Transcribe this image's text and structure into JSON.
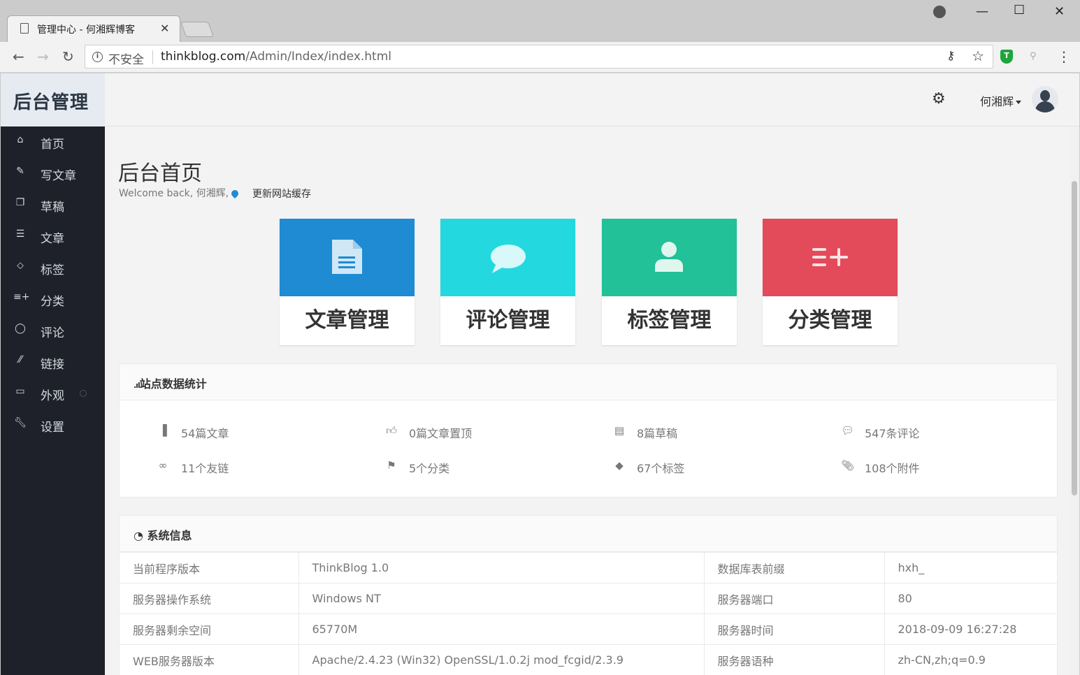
{
  "browser": {
    "tab_title": "管理中心 - 何湘辉博客",
    "tab_close": "✕",
    "insecure_label": "不安全",
    "url_host": "thinkblog.com",
    "url_path": "/Admin/Index/index.html",
    "ext_shield_letter": "T"
  },
  "brand": {
    "title": "后台管理"
  },
  "topbar": {
    "user_name": "何湘辉"
  },
  "sidebar": {
    "items": [
      {
        "label": "首页",
        "icon": "home-icon"
      },
      {
        "label": "写文章",
        "icon": "edit-icon"
      },
      {
        "label": "草稿",
        "icon": "copy-icon"
      },
      {
        "label": "文章",
        "icon": "list-icon"
      },
      {
        "label": "标签",
        "icon": "tag-icon"
      },
      {
        "label": "分类",
        "icon": "category-plus-icon"
      },
      {
        "label": "评论",
        "icon": "comment-icon"
      },
      {
        "label": "链接",
        "icon": "link-icon"
      },
      {
        "label": "外观",
        "icon": "monitor-icon"
      },
      {
        "label": "设置",
        "icon": "wrench-icon"
      }
    ]
  },
  "header": {
    "title": "后台首页",
    "welcome": "Welcome back, 何湘辉,",
    "refresh_cache": "更新网站缓存"
  },
  "cards": [
    {
      "label": "文章管理",
      "color": "#1e8bd3",
      "icon": "document-icon"
    },
    {
      "label": "评论管理",
      "color": "#23d9df",
      "icon": "comment-bubble-icon"
    },
    {
      "label": "标签管理",
      "color": "#22c197",
      "icon": "user-icon"
    },
    {
      "label": "分类管理",
      "color": "#e34a5a",
      "icon": "list-plus-icon"
    }
  ],
  "stats": {
    "title": "站点数据统计",
    "items": [
      {
        "label": "54篇文章",
        "icon": "file-icon"
      },
      {
        "label": "0篇文章置顶",
        "icon": "thumbs-up-icon"
      },
      {
        "label": "8篇草稿",
        "icon": "file-text-icon"
      },
      {
        "label": "547条评论",
        "icon": "comments-icon"
      },
      {
        "label": "11个友链",
        "icon": "link-icon"
      },
      {
        "label": "5个分类",
        "icon": "flag-icon"
      },
      {
        "label": "67个标签",
        "icon": "tags-icon"
      },
      {
        "label": "108个附件",
        "icon": "paperclip-icon"
      }
    ]
  },
  "sysinfo": {
    "title": "系统信息",
    "rows": [
      [
        "当前程序版本",
        "ThinkBlog 1.0",
        "数据库表前缀",
        "hxh_"
      ],
      [
        "服务器操作系统",
        "Windows NT",
        "服务器端口",
        "80"
      ],
      [
        "服务器剩余空间",
        "65770M",
        "服务器时间",
        "2018-09-09 16:27:28"
      ],
      [
        "WEB服务器版本",
        "Apache/2.4.23 (Win32) OpenSSL/1.0.2j mod_fcgid/2.3.9",
        "服务器语种",
        "zh-CN,zh;q=0.9"
      ]
    ]
  }
}
